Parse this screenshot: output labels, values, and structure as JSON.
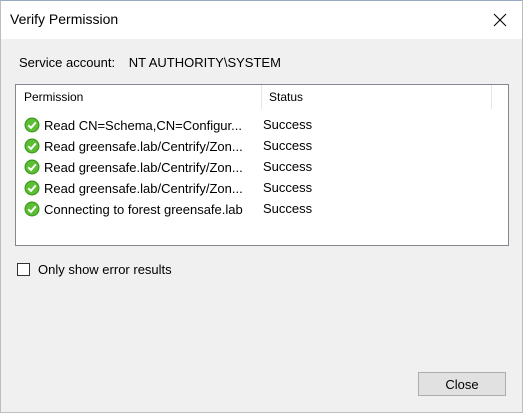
{
  "window": {
    "title": "Verify Permission",
    "close_icon": "close-icon"
  },
  "service_account": {
    "label": "Service account:",
    "value": "NT AUTHORITY\\SYSTEM"
  },
  "list": {
    "columns": [
      "Permission",
      "Status"
    ],
    "rows": [
      {
        "permission": "Read CN=Schema,CN=Configur...",
        "status": "Success",
        "icon": "success-check-icon"
      },
      {
        "permission": "Read greensafe.lab/Centrify/Zon...",
        "status": "Success",
        "icon": "success-check-icon"
      },
      {
        "permission": "Read greensafe.lab/Centrify/Zon...",
        "status": "Success",
        "icon": "success-check-icon"
      },
      {
        "permission": "Read greensafe.lab/Centrify/Zon...",
        "status": "Success",
        "icon": "success-check-icon"
      },
      {
        "permission": "Connecting to forest greensafe.lab",
        "status": "Success",
        "icon": "success-check-icon"
      }
    ]
  },
  "filter": {
    "label": "Only show error results",
    "checked": false
  },
  "buttons": {
    "close_label": "Close"
  },
  "colors": {
    "success_green": "#4caf2a",
    "button_face": "#e1e1e1",
    "dialog_bg": "#f0f0f0"
  }
}
